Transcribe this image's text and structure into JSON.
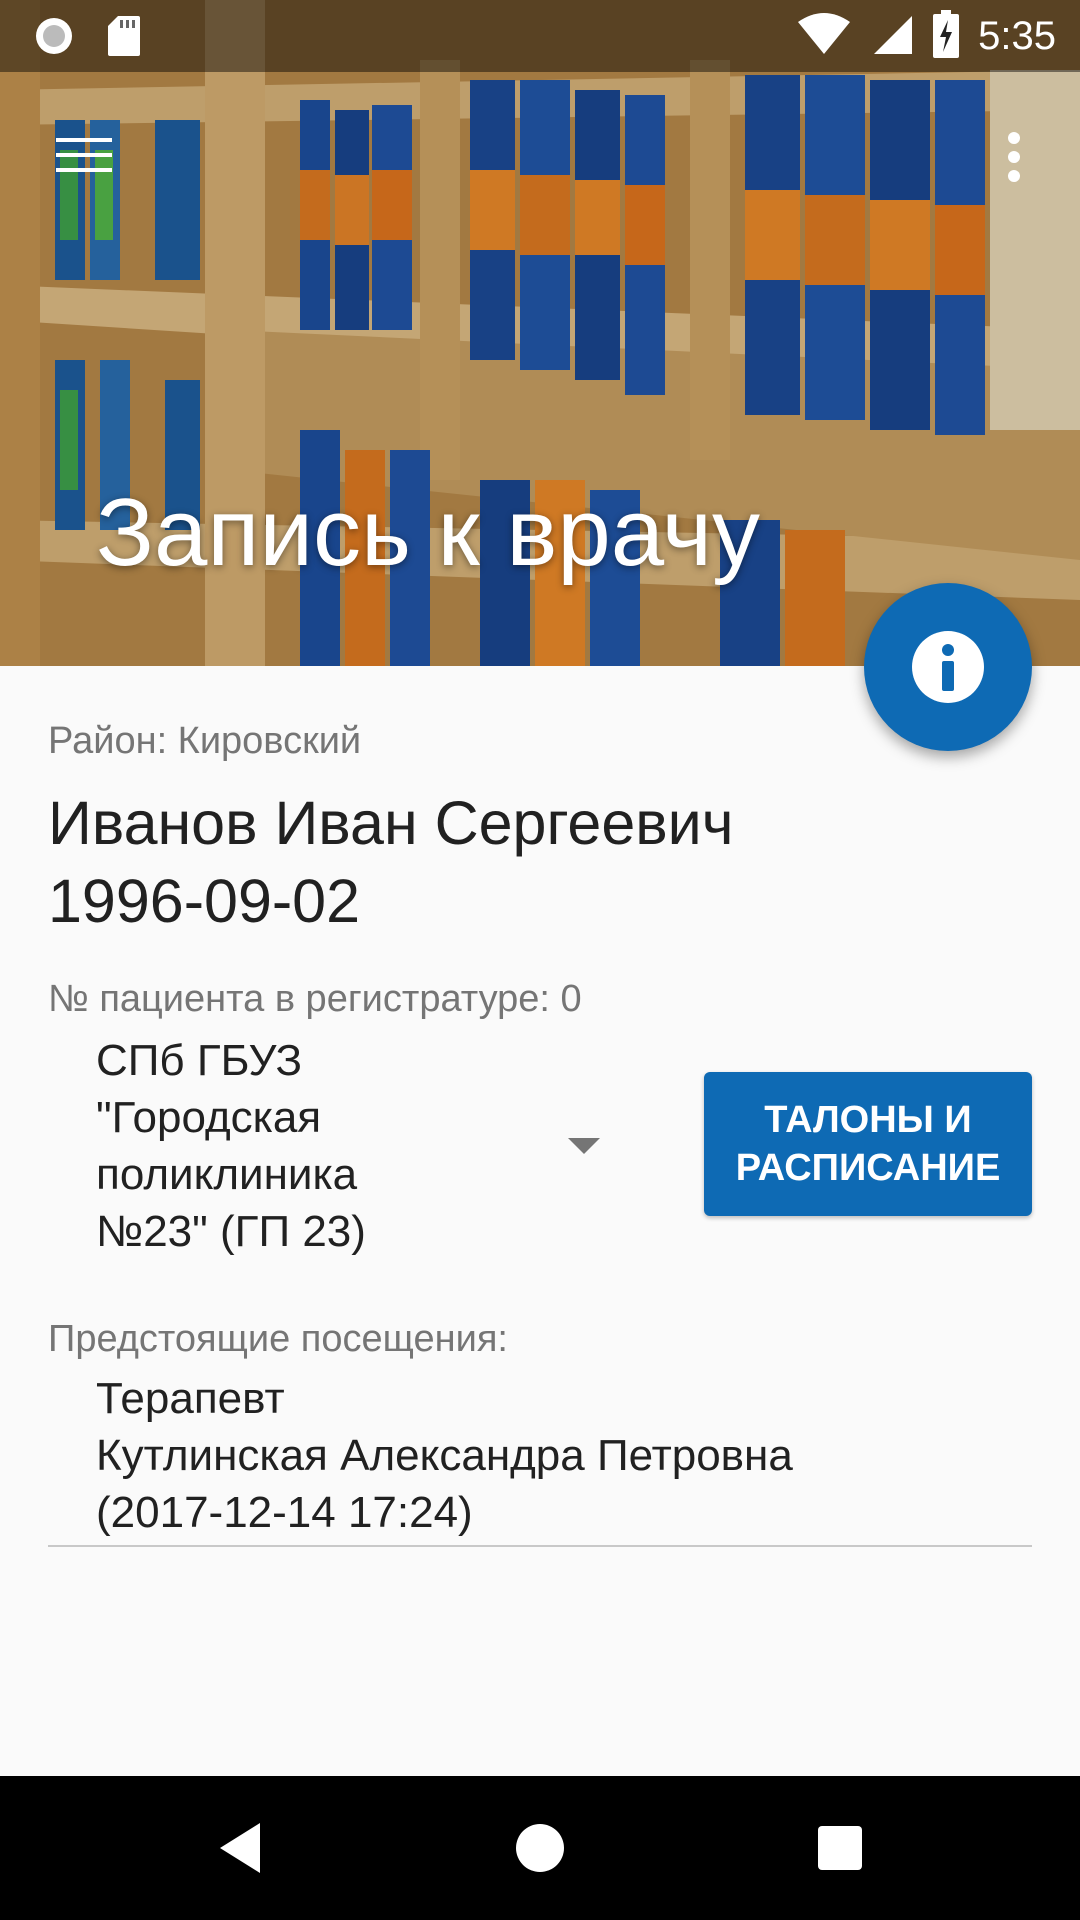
{
  "status_bar": {
    "time": "5:35",
    "icons": [
      "sync-icon",
      "sd-card-icon",
      "wifi-icon",
      "signal-icon",
      "battery-charging-icon"
    ]
  },
  "app_bar": {
    "menu_icon": "hamburger-menu-icon",
    "overflow_icon": "more-vert-icon",
    "title": "Запись к врачу"
  },
  "fab": {
    "icon": "info-icon",
    "color": "#0e6ab4"
  },
  "patient": {
    "district": "Район: Кировский",
    "name": "Иванов Иван Сергеевич",
    "dob": "1996-09-02",
    "registry_number": "№ пациента в регистратуре: 0"
  },
  "clinic": {
    "selected_lines": [
      "СПб ГБУЗ",
      "\"Городская",
      "поликлиника",
      "№23\" (ГП 23)"
    ]
  },
  "tickets_button": {
    "line1": "ТАЛОНЫ И",
    "line2": "РАСПИСАНИЕ"
  },
  "upcoming": {
    "label": "Предстоящие посещения:",
    "items": [
      {
        "specialty": "Терапевт",
        "doctor": "Кутлинская Александра Петровна",
        "datetime": "(2017-12-14 17:24)"
      }
    ]
  },
  "nav_bar": {
    "icons": [
      "back-icon",
      "home-icon",
      "recents-icon"
    ]
  },
  "colors": {
    "accent": "#0e6ab4",
    "background": "#fafafa",
    "secondary_text": "#757575",
    "primary_text": "#212121"
  }
}
